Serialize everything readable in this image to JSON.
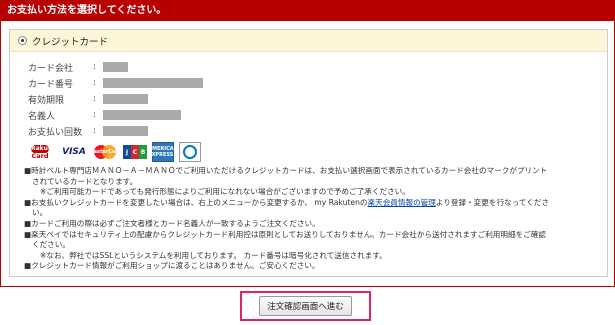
{
  "header": {
    "title": "お支払い方法を選択してください。"
  },
  "method": {
    "label": "クレジットカード"
  },
  "card_info": {
    "rows": [
      {
        "label": "カード会社",
        "colon": ":"
      },
      {
        "label": "カード番号",
        "colon": ":"
      },
      {
        "label": "有効期限",
        "colon": ":"
      },
      {
        "label": "名義人",
        "colon": ":"
      },
      {
        "label": "お支払い回数",
        "colon": ":"
      }
    ]
  },
  "logos": {
    "rakuten_top": "Rakuten",
    "rakuten_bottom": "Card",
    "visa": "VISA",
    "mc": "MasterCard",
    "jcb": [
      "J",
      "C",
      "B"
    ],
    "amex": "AMERICAN EXPRESS"
  },
  "notes": {
    "n1": "■時計ベルト専門店ＭＡＮＯ－Ａ－ＭＡＮＯでご利用いただけるクレジットカードは、お支払い選択画面で表示されているカード会社のマークがプリント",
    "n1b": "されているカードとなります。",
    "n1c": "※ご利用可能カードであっても発行形態によりご利用になれない場合がございますので予めご了承ください。",
    "n2a": "■お支払いクレジットカードを変更したい場合は、右上のメニューから変更するか、 my Rakutenの",
    "n2link": "楽天会員情報の管理",
    "n2b": "より登録・変更を行なってくださ",
    "n2c": "い。",
    "n3": "■カードご利用の際は必ずご注文者様とカード名義人が一致するようご注文ください。",
    "n4": "■楽天ペイではセキュリティ上の配慮からクレジットカード利用控は原則としてお送りしておりません。カード会社から送付されますご利用明細をご確認",
    "n4b": "ください。",
    "n5": "※なお、弊社ではSSLというシステムを利用しております。 カード番号は暗号化されて送信されます。",
    "n6": "■クレジットカード情報がご利用ショップに渡ることはありません。ご安心ください。"
  },
  "submit": {
    "label": "注文確認画面へ進む"
  },
  "colors": {
    "header": "#b80000",
    "highlight_border": "#e0245e"
  }
}
